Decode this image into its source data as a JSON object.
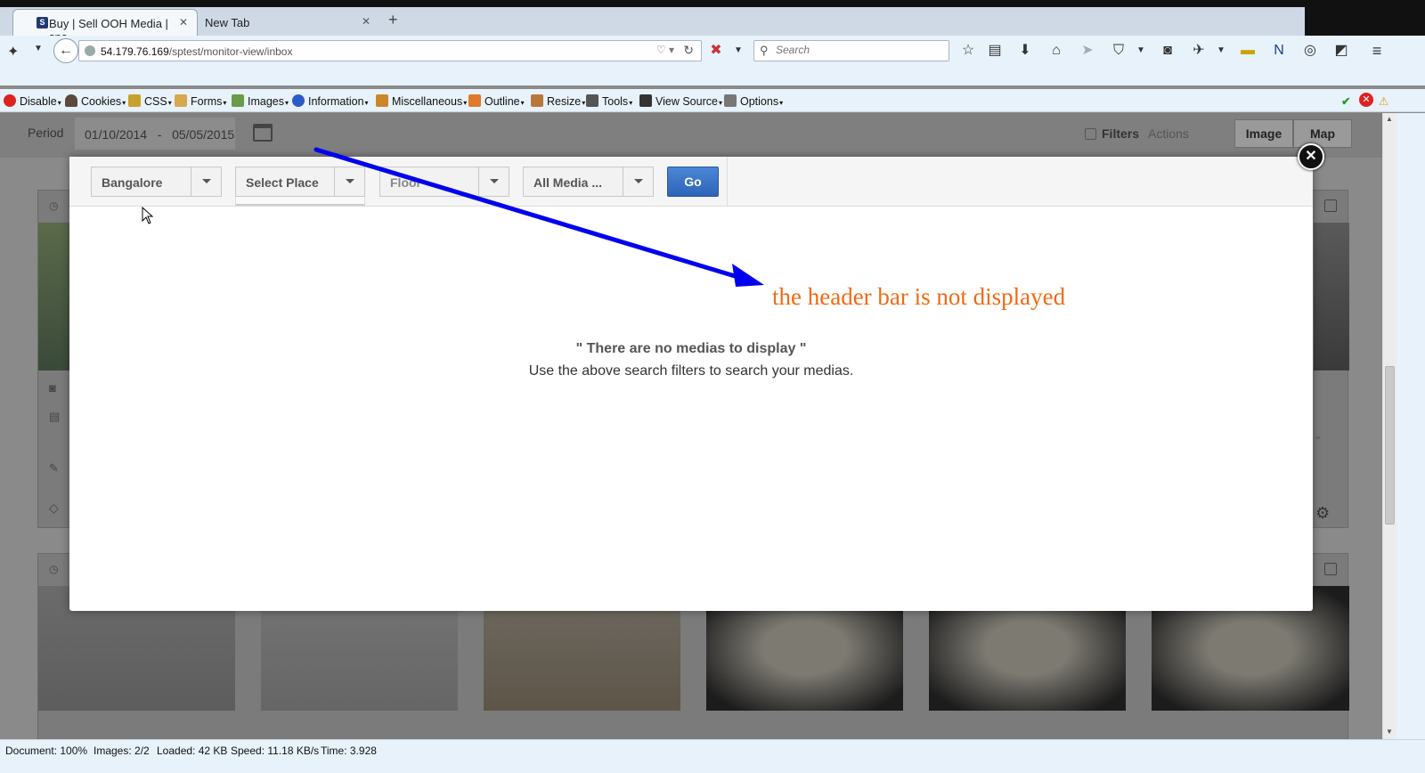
{
  "browser": {
    "tabs": [
      {
        "title": "Buy | Sell OOH Media | sna...",
        "active": true
      },
      {
        "title": "New Tab",
        "active": false
      }
    ],
    "url_host": "54.179.76.169",
    "url_path": "/sptest/monitor-view/inbox",
    "search_placeholder": "Search"
  },
  "devtoolbar": {
    "items": [
      "Disable",
      "Cookies",
      "CSS",
      "Forms",
      "Images",
      "Information",
      "Miscellaneous",
      "Outline",
      "Resize",
      "Tools",
      "View Source",
      "Options"
    ]
  },
  "filterbar": {
    "period_label": "Period",
    "date_from": "01/10/2014",
    "date_sep": "-",
    "date_to": "05/05/2015",
    "filters_label": "Filters",
    "actions_label": "Actions",
    "view_image": "Image",
    "view_map": "Map"
  },
  "modal": {
    "city": "Bangalore",
    "place": "Select Place",
    "floor": "Floor",
    "media": "All Media ...",
    "go": "Go",
    "empty_title": "\" There are no medias to display \"",
    "empty_hint": "Use the above search filters to search your medias."
  },
  "annotation": {
    "text": "the header bar is not displayed",
    "color": "#f26a12",
    "arrow_color": "#0000ee"
  },
  "statusbar": {
    "document": "Document: 100%",
    "images": "Images: 2/2",
    "loaded": "Loaded: 42 KB",
    "speed": "Speed: 11.18 KB/s",
    "time": "Time: 3.928"
  }
}
